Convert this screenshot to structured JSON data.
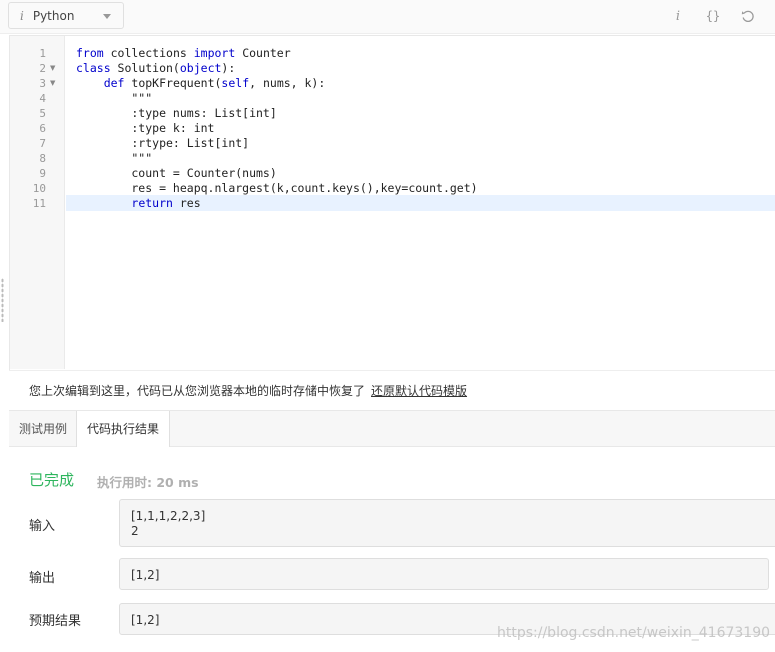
{
  "toolbar": {
    "language": "Python",
    "info_glyph": "i",
    "format_glyph": "{}",
    "icons": [
      "info-icon",
      "format-braces-icon",
      "reset-icon"
    ]
  },
  "editor": {
    "line_numbers": [
      "1",
      "2",
      "3",
      "4",
      "5",
      "6",
      "7",
      "8",
      "9",
      "10",
      "11"
    ],
    "folds": [
      "2",
      "3"
    ],
    "active_line": "11",
    "code": {
      "l1_kw1": "from",
      "l1_mid": " collections ",
      "l1_kw2": "import",
      "l1_end": " Counter",
      "l2_kw": "class",
      "l2_name": " Solution(",
      "l2_base": "object",
      "l2_end": "):",
      "l3_indent": "    ",
      "l3_kw": "def",
      "l3_name": " topKFrequent(",
      "l3_self": "self",
      "l3_end": ", nums, k):",
      "l4": "        \"\"\"",
      "l5": "        :type nums: List[int]",
      "l6": "        :type k: int",
      "l7": "        :rtype: List[int]",
      "l8": "        \"\"\"",
      "l9": "        count = Counter(nums)",
      "l10": "        res = heapq.nlargest(k,count.keys(),key=count.get)",
      "l11_indent": "        ",
      "l11_kw": "return",
      "l11_end": " res"
    }
  },
  "notice": {
    "message": "您上次编辑到这里，代码已从您浏览器本地的临时存储中恢复了",
    "restore_link": "还原默认代码模版"
  },
  "tabs": {
    "tests": "测试用例",
    "result": "代码执行结果"
  },
  "result": {
    "status": "已完成",
    "runtime": "执行用时: 20 ms",
    "input_label": "输入",
    "input_line1": "[1,1,1,2,2,3]",
    "input_line2": "2",
    "output_label": "输出",
    "output_value": "[1,2]",
    "expected_label": "预期结果",
    "expected_value": "[1,2]"
  },
  "watermark": "https://blog.csdn.net/weixin_41673190",
  "colors": {
    "accent_green": "#2db55d",
    "keyword_blue": "#0000cc",
    "active_line": "#e8f2ff"
  }
}
